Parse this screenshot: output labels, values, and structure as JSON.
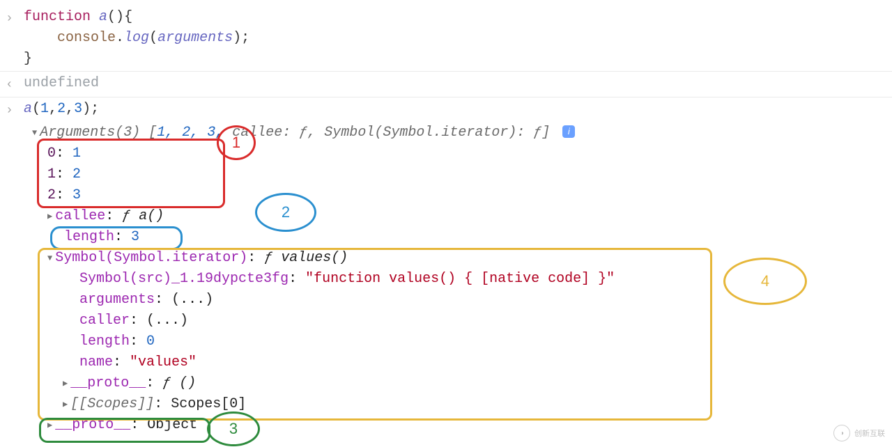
{
  "input1": {
    "kw_function": "function",
    "name": "a",
    "parens": "()",
    "brace_open": "{",
    "console": "console",
    "log": "log",
    "arguments": "arguments",
    "line_end": ");",
    "brace_close": "}"
  },
  "output1": "undefined",
  "input2": "a(1,2,3);",
  "summary": {
    "prefix": "Arguments(3)",
    "bracket_open": "[",
    "vals": "1, 2, 3,",
    "rest": " callee: ƒ, Symbol(Symbol.iterator): ƒ]",
    "info": "i"
  },
  "entries": {
    "e0_k": "0",
    "e0_v": "1",
    "e1_k": "1",
    "e1_v": "2",
    "e2_k": "2",
    "e2_v": "3"
  },
  "callee": {
    "key": "callee",
    "val": "ƒ a()"
  },
  "length": {
    "key": "length",
    "val": "3"
  },
  "iterator": {
    "key": "Symbol(Symbol.iterator)",
    "val": "ƒ values()",
    "src_key": "Symbol(src)_1.19dypcte3fg",
    "src_val": "\"function values() { [native code] }\"",
    "arguments_key": "arguments",
    "arguments_val": "(...)",
    "caller_key": "caller",
    "caller_val": "(...)",
    "length_key": "length",
    "length_val": "0",
    "name_key": "name",
    "name_val": "\"values\"",
    "proto_key": "__proto__",
    "proto_val": "ƒ ()",
    "scopes_key": "[[Scopes]]",
    "scopes_val": "Scopes[0]"
  },
  "proto": {
    "key": "__proto__",
    "val": "Object"
  },
  "annotations": {
    "n1": "1",
    "n2": "2",
    "n3": "3",
    "n4": "4"
  },
  "watermark": "创新互联"
}
